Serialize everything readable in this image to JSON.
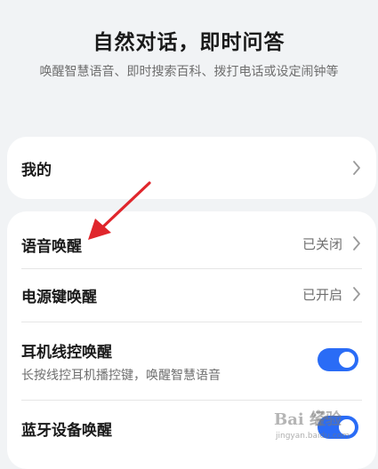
{
  "header": {
    "title": "自然对话，即时问答",
    "subtitle": "唤醒智慧语音、即时搜索百科、拨打电话或设定闹钟等"
  },
  "mine": {
    "label": "我的"
  },
  "wake_settings": {
    "voice_wake": {
      "label": "语音唤醒",
      "value": "已关闭"
    },
    "power_key_wake": {
      "label": "电源键唤醒",
      "value": "已开启"
    },
    "earphone_wake": {
      "label": "耳机线控唤醒",
      "description": "长按线控耳机播控键，唤醒智慧语音",
      "enabled": true
    },
    "bluetooth_wake": {
      "label": "蓝牙设备唤醒",
      "enabled": true
    }
  },
  "watermark": {
    "text": "Bai 经验",
    "url": "jingyan.baidu.com"
  },
  "colors": {
    "accent": "#2a6cf6",
    "annotation_arrow": "#e0262c"
  }
}
